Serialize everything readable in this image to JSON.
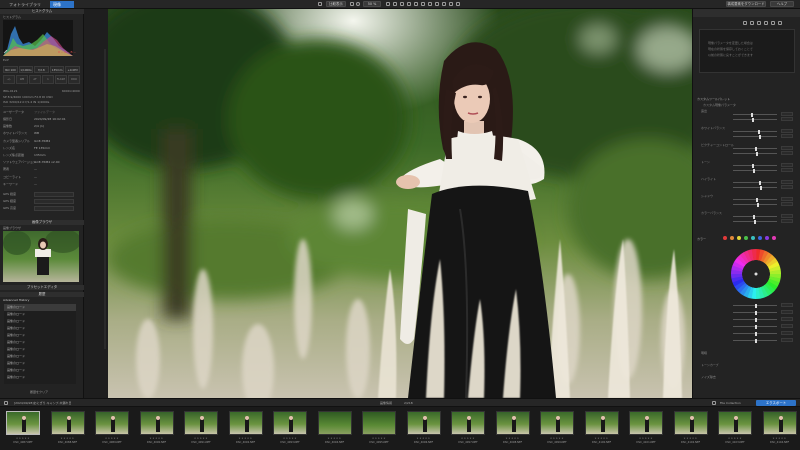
{
  "tabs": [
    "フォトライブラリ",
    "現像"
  ],
  "toolbar": {
    "compare_label": "比較表示",
    "zoom_label": "50 %",
    "right_btn1": "構成要素をダウンロード",
    "right_btn2": "ボタンを設定",
    "right_btn3": "ヘルプ"
  },
  "left_panel": {
    "histogram_header": "ヒストグラム",
    "histogram_sub": "ヒストグラム",
    "rgb_readout": "R -- G -- B --",
    "exif_label": "Exif",
    "exif_values": [
      "ISO 100",
      "1/1000s",
      "f/2.8",
      "135mm",
      "+0.0EV"
    ],
    "exif_icons": [
      "+/-",
      "WB",
      "AF",
      "1",
      "FLASH",
      "DRO"
    ],
    "file_name": "IMG-0121",
    "file_dims": "6000×4000",
    "info_lines": [
      "SP 8.9/4000 100mm F2.8 DI OSD",
      "ISO 3200/12.0 f/1.4 IN 1/4000s"
    ],
    "metadata_tabs": [
      "ユーザーデータ",
      "ファイルデータ"
    ],
    "metadata_rows": [
      {
        "label": "撮影日",
        "value": "2024/09/28 16:02:01"
      },
      {
        "label": "画像数",
        "value": "2/4 (1)"
      },
      {
        "label": "ホワイトバランス",
        "value": "WB"
      },
      {
        "label": "カメラ型番シリアル",
        "value": "ILCE-7RM4"
      },
      {
        "label": "レンズ名",
        "value": "FE 135mm"
      },
      {
        "label": "レンズ焦点距離",
        "value": "135mm"
      },
      {
        "label": "ソフトウェアバージョン",
        "value": "ILCE-7RM4 v2.00"
      },
      {
        "label": "著者",
        "value": "—"
      },
      {
        "label": "コピーライト",
        "value": "—"
      },
      {
        "label": "キーワード",
        "value": "—"
      }
    ],
    "gps_rows": [
      "GPS 緯度",
      "GPS 経度",
      "GPS 高度"
    ],
    "nav_header": "画像ブラウザ",
    "nav_sub": "画像ブラウザ",
    "preset_header": "プリセットエディタ",
    "history_header": "履歴",
    "history_group": "Advanced History",
    "history_items": [
      "画像のロード",
      "画像のロード",
      "画像のロード",
      "画像のロード",
      "画像のロード",
      "画像のロード",
      "画像のロード",
      "画像のロード",
      "画像のロード",
      "画像のロード",
      "画像のロード"
    ],
    "bottom_button": "履歴をクリア"
  },
  "right_panel": {
    "top_hint_lines": [
      "現像パラメータを変更した場合は",
      "現在の状態を保存しておくことで",
      "以前の状態に戻すことができます"
    ],
    "section1": "カスタムツールパレット",
    "section1_sub": "カスタム現像パラメータ",
    "slider_sections": [
      "露出",
      "ホワイトバランス",
      "ピクチャーコントロール",
      "トーン",
      "ハイライト",
      "シャドウ",
      "カラーバランス"
    ],
    "color_section": "カラー",
    "bottom_sections": [
      "明暗",
      "トーンカーブ",
      "ノイズ除去"
    ]
  },
  "filmbar": {
    "path_text": "[2024/09/28]おにぎり,キャンプ,木漏れ日",
    "count_text": "2/218",
    "center_label": "画像情報",
    "file_collection": "File Collection",
    "export_button": "エクスポート"
  },
  "thumbnails": [
    {
      "label": "DSC_4087.NEF",
      "kind": "portrait"
    },
    {
      "label": "DSC_4088.NEF",
      "kind": "field"
    },
    {
      "label": "DSC_4089.NEF",
      "kind": "field"
    },
    {
      "label": "DSC_4090.NEF",
      "kind": "field"
    },
    {
      "label": "DSC_4091.NEF",
      "kind": "field"
    },
    {
      "label": "DSC_4092.NEF",
      "kind": "portrait"
    },
    {
      "label": "DSC_4093.NEF",
      "kind": "portrait"
    },
    {
      "label": "DSC_4094.NEF",
      "kind": "green"
    },
    {
      "label": "DSC_4095.NEF",
      "kind": "green"
    },
    {
      "label": "DSC_4096.NEF",
      "kind": "portrait"
    },
    {
      "label": "DSC_4097.NEF",
      "kind": "portrait"
    },
    {
      "label": "DSC_4098.NEF",
      "kind": "field"
    },
    {
      "label": "DSC_4099.NEF",
      "kind": "portrait"
    },
    {
      "label": "DSC_4100.NEF",
      "kind": "field"
    },
    {
      "label": "DSC_4101.NEF",
      "kind": "portrait"
    },
    {
      "label": "DSC_4102.NEF",
      "kind": "field"
    },
    {
      "label": "DSC_4103.NEF",
      "kind": "portrait"
    },
    {
      "label": "DSC_4104.NEF",
      "kind": "field"
    }
  ],
  "thumbnail_stars": "★★★★★",
  "colors": {
    "accent": "#2d73c8",
    "panel": "#232323",
    "viewer_bg": "#151515"
  }
}
